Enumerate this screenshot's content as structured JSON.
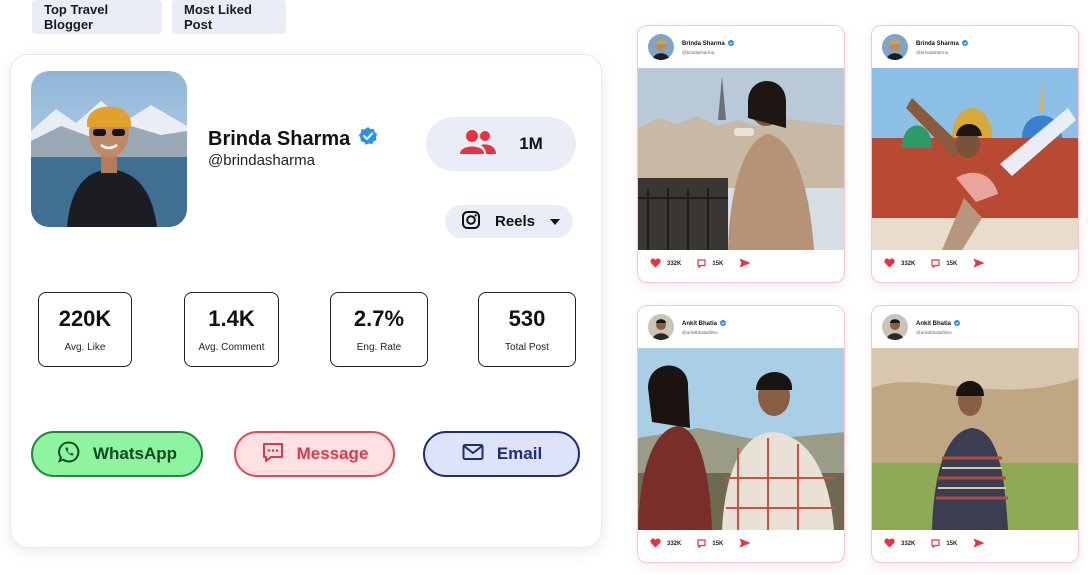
{
  "chips": {
    "top_blogger": "Top Travel Blogger",
    "most_liked": "Most Liked Post"
  },
  "profile": {
    "name": "Brinda Sharma",
    "handle": "@brindasharma",
    "followers": "1M",
    "platform": "Reels",
    "verified_color": "#2d8ff0"
  },
  "stats": [
    {
      "value": "220K",
      "label": "Avg. Like"
    },
    {
      "value": "1.4K",
      "label": "Avg. Comment"
    },
    {
      "value": "2.7%",
      "label": "Eng. Rate"
    },
    {
      "value": "530",
      "label": "Total Post"
    }
  ],
  "actions": {
    "whatsapp": "WhatsApp",
    "message": "Message",
    "email": "Email"
  },
  "posts": [
    {
      "name": "Brinda Sharma",
      "handle": "@brindasharma",
      "likes": "332K",
      "comments": "15K"
    },
    {
      "name": "Brinda Sharma",
      "handle": "@brindasharma",
      "likes": "332K",
      "comments": "15K"
    },
    {
      "name": "Ankit Bhatia",
      "handle": "@ankitbhatiafilms",
      "likes": "332K",
      "comments": "15K"
    },
    {
      "name": "Ankit Bhatia",
      "handle": "@ankitbhatiafilms",
      "likes": "332K",
      "comments": "15K"
    }
  ],
  "icons": {
    "followers": "users-icon",
    "platform": "instagram-icon",
    "dropdown": "caret-down-icon",
    "whatsapp": "whatsapp-icon",
    "message": "chat-icon",
    "email": "mail-icon",
    "like": "heart-icon",
    "comment": "comment-icon",
    "share": "send-icon"
  },
  "colors": {
    "accent_red": "#e8323f",
    "chip_bg": "#e9edf8"
  }
}
